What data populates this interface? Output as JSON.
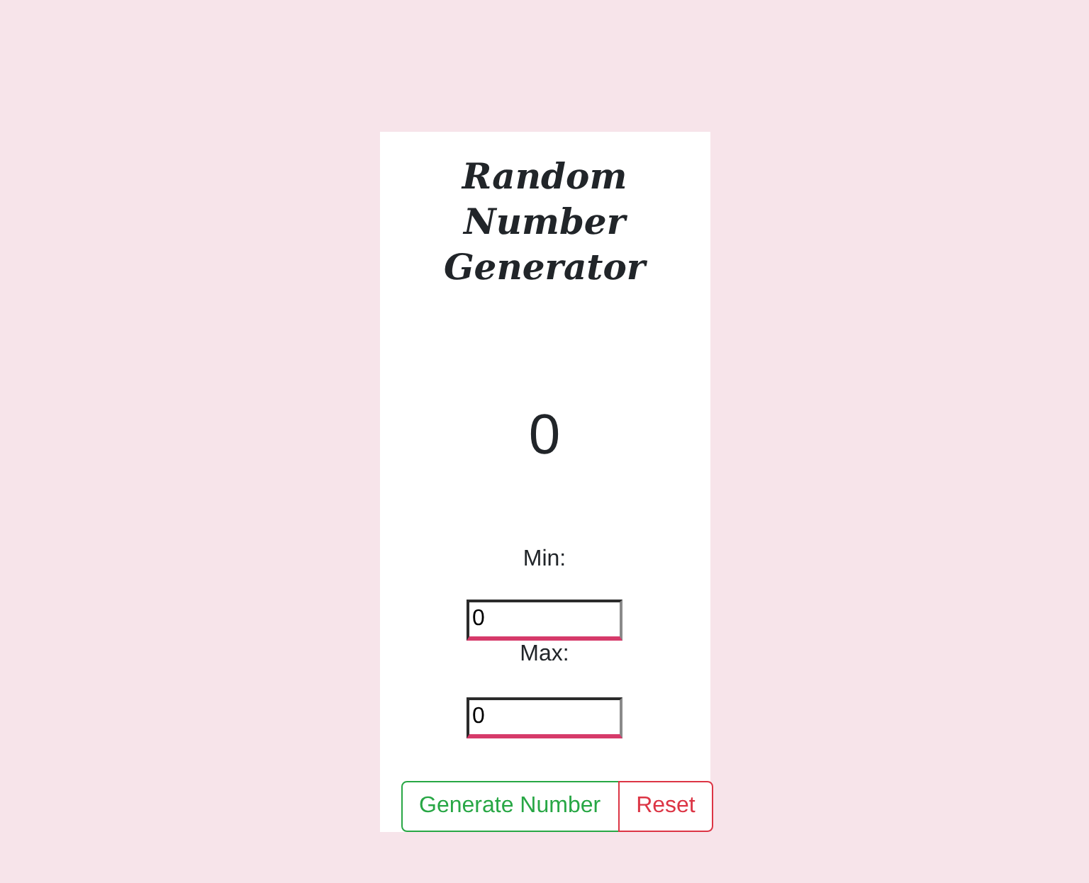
{
  "title": "Random Number Generator",
  "result": "0",
  "fields": [
    {
      "label": "Min:",
      "value": "0"
    },
    {
      "label": "Max:",
      "value": "0"
    }
  ],
  "buttons": [
    {
      "label": "Generate Number",
      "kind": "generate"
    },
    {
      "label": "Reset",
      "kind": "reset"
    }
  ]
}
